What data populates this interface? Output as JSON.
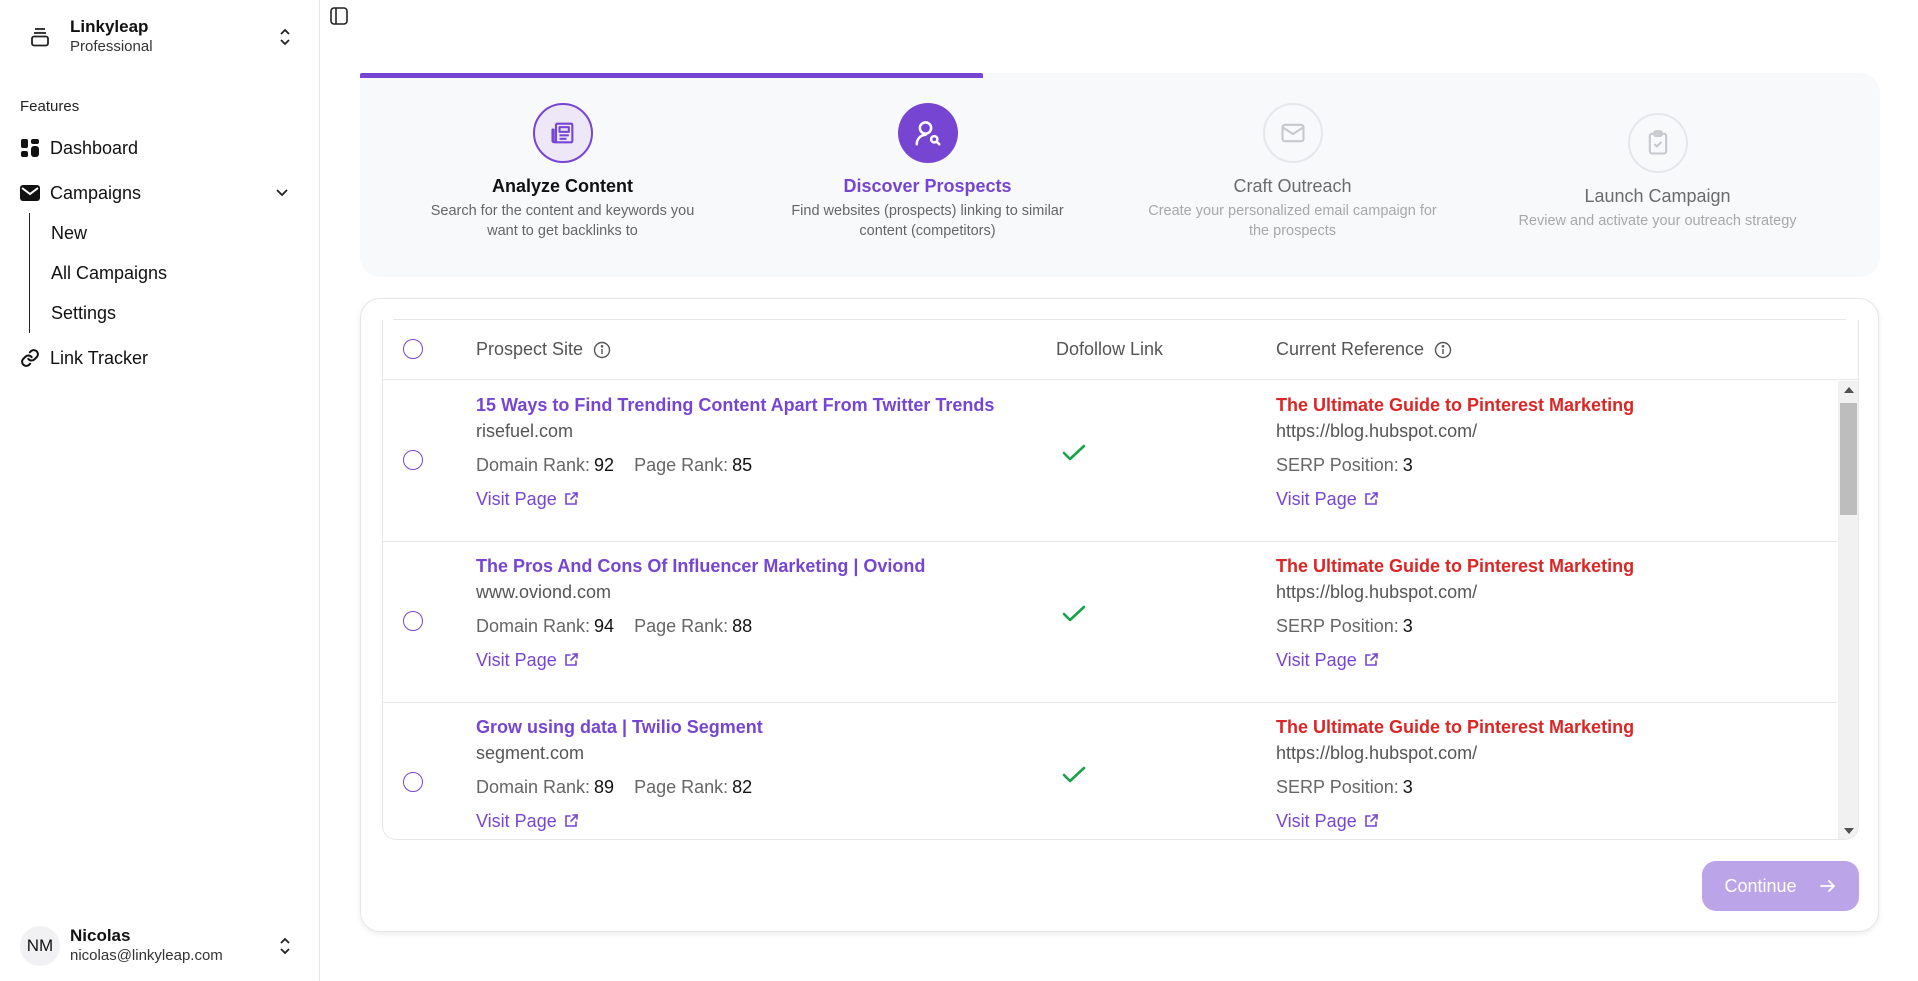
{
  "sidebar": {
    "brand": {
      "name": "Linkyleap",
      "plan": "Professional",
      "icon": "stack-icon"
    },
    "section_label": "Features",
    "items": [
      {
        "label": "Dashboard",
        "icon": "dashboard-icon"
      },
      {
        "label": "Campaigns",
        "icon": "mail-icon",
        "expanded": true,
        "children": [
          {
            "label": "New"
          },
          {
            "label": "All Campaigns"
          },
          {
            "label": "Settings"
          }
        ]
      },
      {
        "label": "Link Tracker",
        "icon": "link-icon"
      }
    ],
    "user": {
      "initials": "NM",
      "name": "Nicolas",
      "email": "nicolas@linkyleap.com"
    }
  },
  "stepper": {
    "progress_fraction": 0.41,
    "colors": {
      "accent": "#7646d2",
      "done_bg": "#ede7f8",
      "todo_border": "#e5e7eb"
    },
    "steps": [
      {
        "title": "Analyze Content",
        "desc_line1": "Search for the content and keywords you",
        "desc_line2": "want to get backlinks to",
        "status": "done",
        "icon": "newspaper-icon"
      },
      {
        "title": "Discover Prospects",
        "desc_line1": "Find websites (prospects) linking to similar",
        "desc_line2": "content (competitors)",
        "status": "active",
        "icon": "user-search-icon"
      },
      {
        "title": "Craft Outreach",
        "desc_line1": "Create your personalized email campaign for",
        "desc_line2": "the prospects",
        "status": "todo",
        "icon": "mail-icon"
      },
      {
        "title": "Launch Campaign",
        "desc_line1": "Review and activate your outreach strategy",
        "desc_line2": "",
        "status": "todo",
        "icon": "clipboard-check-icon"
      }
    ]
  },
  "table": {
    "columns": {
      "prospect": "Prospect Site",
      "dofollow": "Dofollow Link",
      "reference": "Current Reference"
    },
    "labels": {
      "domain_rank": "Domain Rank:",
      "page_rank": "Page Rank:",
      "serp_position": "SERP Position:",
      "visit_page": "Visit Page"
    },
    "rows": [
      {
        "title": "15 Ways to Find Trending Content Apart From Twitter Trends",
        "domain": "risefuel.com",
        "domain_rank": "92",
        "page_rank": "85",
        "dofollow": true,
        "ref_title": "The Ultimate Guide to Pinterest Marketing",
        "ref_url": "https://blog.hubspot.com/",
        "serp_position": "3"
      },
      {
        "title": "The Pros And Cons Of Influencer Marketing | Oviond",
        "domain": "www.oviond.com",
        "domain_rank": "94",
        "page_rank": "88",
        "dofollow": true,
        "ref_title": "The Ultimate Guide to Pinterest Marketing",
        "ref_url": "https://blog.hubspot.com/",
        "serp_position": "3"
      },
      {
        "title": "Grow using data | Twilio Segment",
        "domain": "segment.com",
        "domain_rank": "89",
        "page_rank": "82",
        "dofollow": true,
        "ref_title": "The Ultimate Guide to Pinterest Marketing",
        "ref_url": "https://blog.hubspot.com/",
        "serp_position": "3"
      }
    ]
  },
  "footer": {
    "continue_label": "Continue",
    "continue_enabled": false
  }
}
